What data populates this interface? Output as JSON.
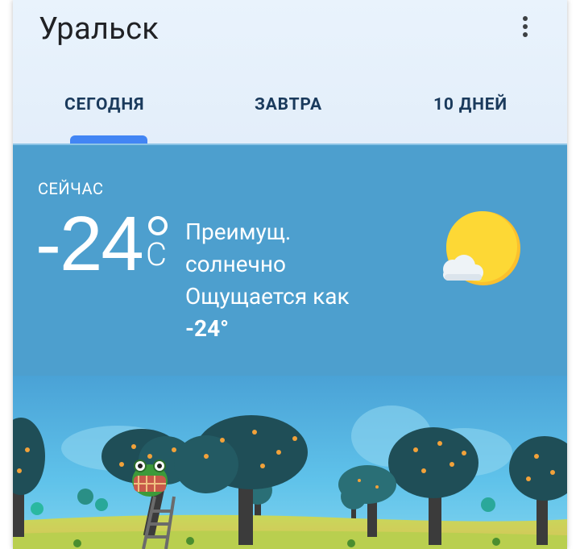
{
  "header": {
    "city": "Уральск"
  },
  "tabs": [
    {
      "label": "СЕГОДНЯ",
      "selected": true
    },
    {
      "label": "ЗАВТРА",
      "selected": false
    },
    {
      "label": "10 ДНЕЙ",
      "selected": false
    }
  ],
  "current": {
    "label": "СЕЙЧАС",
    "temperature": "-24",
    "unit": "C",
    "condition_line1": "Преимущ.",
    "condition_line2": "солнечно",
    "feels_like_label": "Ощущается как",
    "feels_like_value": "-24°",
    "icon": "sun-with-cloud-icon"
  },
  "colors": {
    "accent": "#4285f4",
    "now_panel": "#4d9fce",
    "header_bg": "#e9f3fc",
    "tab_text": "#1a3a5c"
  }
}
